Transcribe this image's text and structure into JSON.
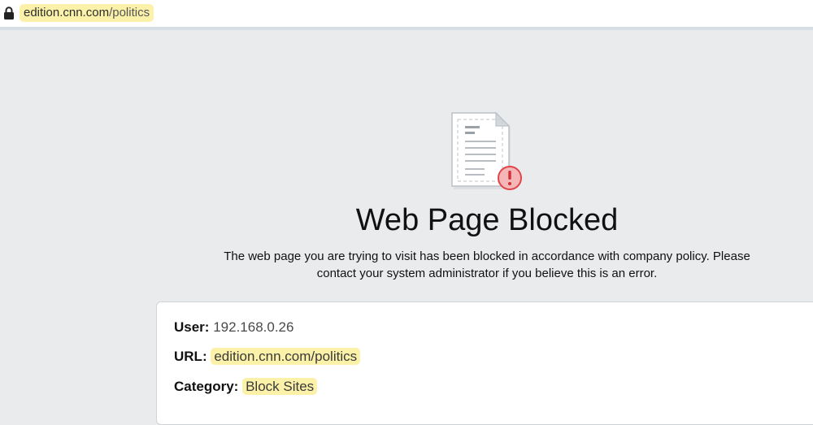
{
  "address_bar": {
    "url_host": "edition.cnn.com",
    "url_path": "/politics"
  },
  "blocked_page": {
    "title": "Web Page Blocked",
    "message": "The web page you are trying to visit has been blocked in accordance with company policy. Please contact your system administrator if you believe this is an error.",
    "details": {
      "user_label": "User:",
      "user_value": "192.168.0.26",
      "url_label": "URL:",
      "url_value": "edition.cnn.com/politics",
      "category_label": "Category:",
      "category_value": "Block Sites"
    }
  },
  "icons": {
    "lock": "lock-icon",
    "document": "document-icon",
    "alert": "alert-icon"
  },
  "colors": {
    "highlight": "#fbf1a9",
    "page_background": "#e9ebed",
    "alert_red": "#e0454a"
  }
}
